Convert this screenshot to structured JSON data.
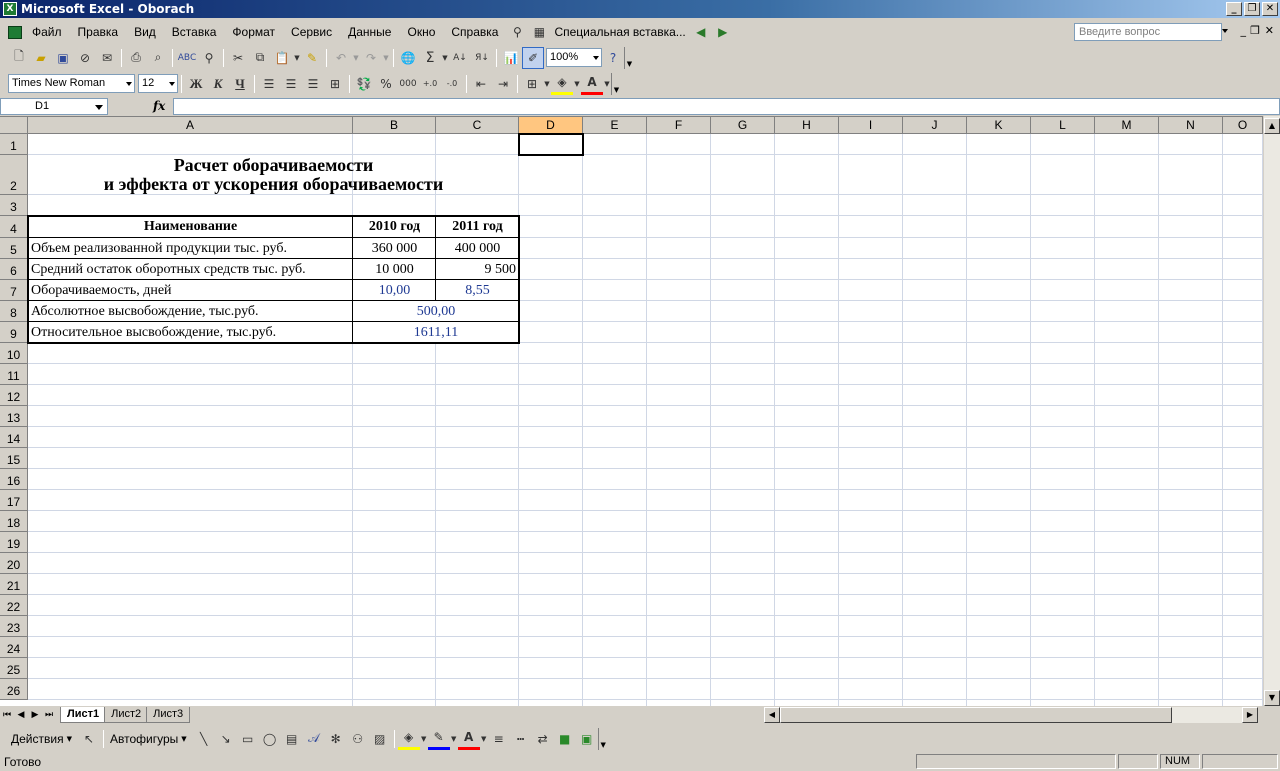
{
  "window": {
    "title": "Microsoft Excel - Oborach"
  },
  "menu": {
    "items": [
      "Файл",
      "Правка",
      "Вид",
      "Вставка",
      "Формат",
      "Сервис",
      "Данные",
      "Окно",
      "Справка"
    ],
    "special": "Специальная вставка...",
    "help_placeholder": "Введите вопрос"
  },
  "toolbar": {
    "zoom": "100%",
    "font": "Times New Roman",
    "size": "12",
    "bold": "Ж",
    "italic": "К",
    "underline": "Ч",
    "percent": "%",
    "thousands": "000"
  },
  "formula": {
    "namebox": "D1",
    "fx": "fx"
  },
  "columns": [
    "A",
    "B",
    "C",
    "D",
    "E",
    "F",
    "G",
    "H",
    "I",
    "J",
    "K",
    "L",
    "M",
    "N",
    "O"
  ],
  "rows": [
    "1",
    "2",
    "3",
    "4",
    "5",
    "6",
    "7",
    "8",
    "9",
    "10",
    "11",
    "12",
    "13",
    "14",
    "15",
    "16",
    "17",
    "18",
    "19",
    "20",
    "21",
    "22",
    "23",
    "24",
    "25",
    "26"
  ],
  "sheet": {
    "title1": "Расчет оборачиваемости",
    "title2": "и эффекта от ускорения оборачиваемости",
    "h_name": "Наименование",
    "h_2010": "2010 год",
    "h_2011": "2011 год",
    "r5": {
      "name": "Объем реализованной продукции тыс. руб.",
      "b": "360 000",
      "c": "400 000"
    },
    "r6": {
      "name": "Средний остаток оборотных средств тыс. руб.",
      "b": "10 000",
      "c": "9 500"
    },
    "r7": {
      "name": "Оборачиваемость, дней",
      "b": "10,00",
      "c": "8,55"
    },
    "r8": {
      "name": "Абсолютное высвобождение, тыс.руб.",
      "bc": "500,00"
    },
    "r9": {
      "name": "Относительное высвобождение, тыс.руб.",
      "bc": "1611,11"
    }
  },
  "tabs": [
    "Лист1",
    "Лист2",
    "Лист3"
  ],
  "drawing": {
    "actions": "Действия",
    "autoshapes": "Автофигуры"
  },
  "status": {
    "ready": "Готово",
    "num": "NUM"
  }
}
